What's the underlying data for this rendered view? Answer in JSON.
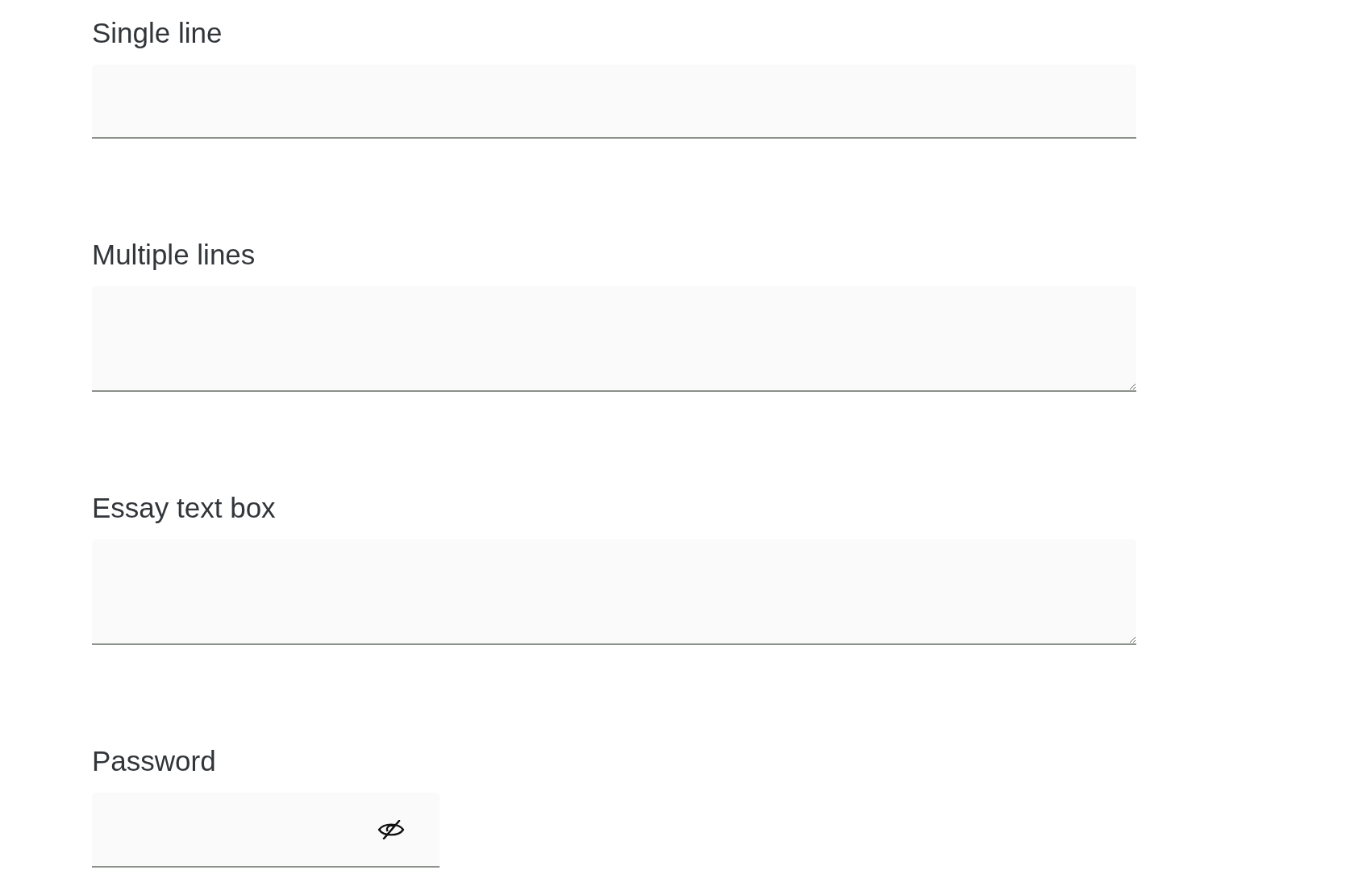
{
  "questions": [
    {
      "label": "Single line",
      "kind": "single_line"
    },
    {
      "label": "Multiple lines",
      "kind": "multi_line"
    },
    {
      "label": "Essay text box",
      "kind": "essay"
    },
    {
      "label": "Password",
      "kind": "password",
      "shown": false
    }
  ]
}
